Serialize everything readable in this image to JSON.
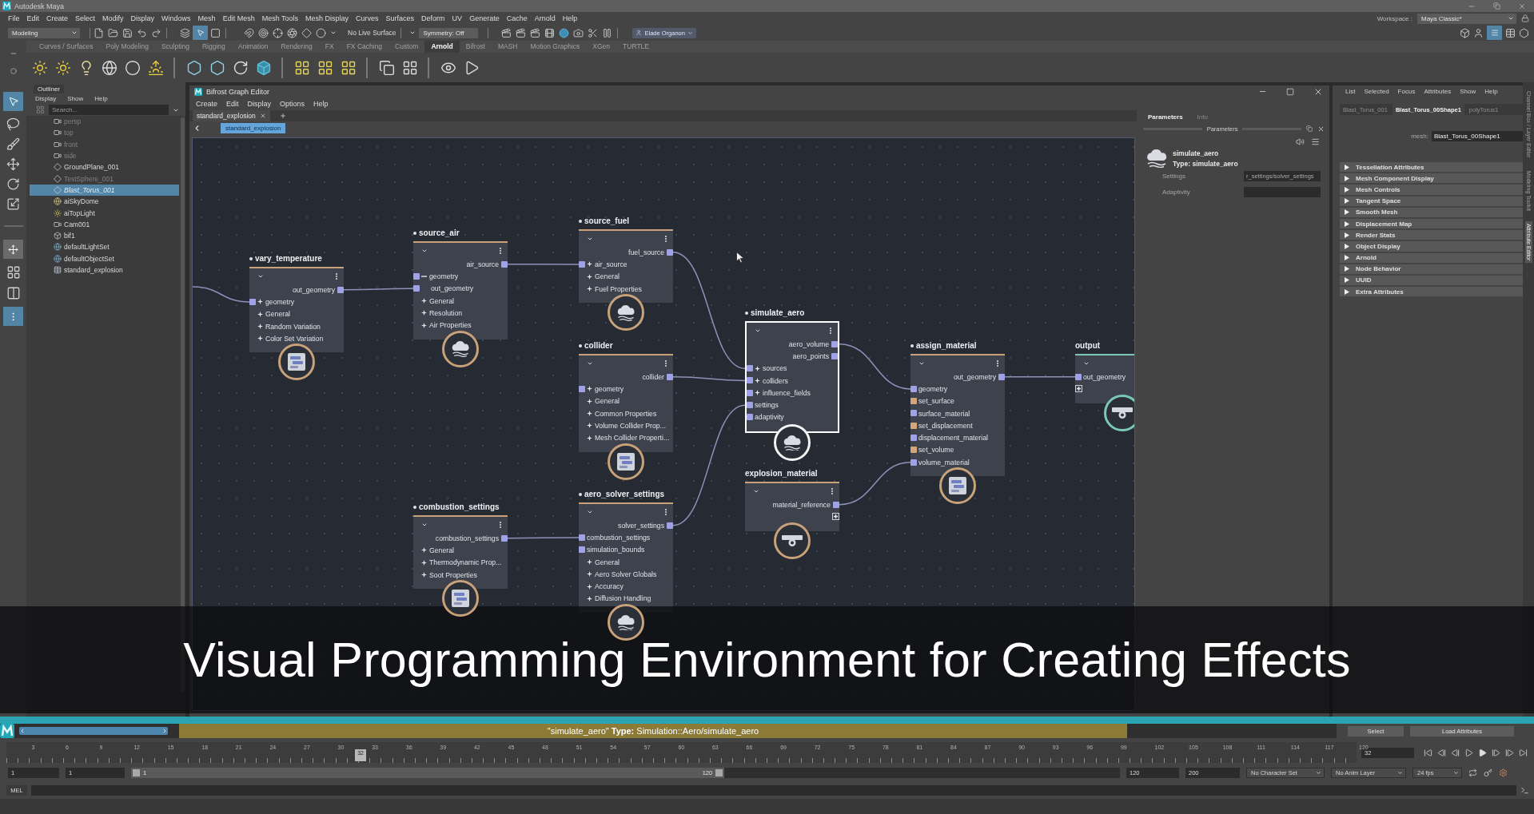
{
  "window": {
    "title": "Autodesk Maya"
  },
  "menu_bar": {
    "items": [
      "File",
      "Edit",
      "Create",
      "Select",
      "Modify",
      "Display",
      "Windows",
      "Mesh",
      "Edit Mesh",
      "Mesh Tools",
      "Mesh Display",
      "Curves",
      "Surfaces",
      "Deform",
      "UV",
      "Generate",
      "Cache",
      "Arnold",
      "Help"
    ],
    "workspace_label": "Workspace :",
    "workspace": "Maya Classic*"
  },
  "status_line": {
    "mode": "Modeling",
    "live_surface": "No Live Surface",
    "symmetry": "Symmetry: Off",
    "account": "Elade Organon"
  },
  "shelf": {
    "tabs": [
      {
        "label": "Curves / Surfaces",
        "selected": false
      },
      {
        "label": "Poly Modeling",
        "selected": false
      },
      {
        "label": "Sculpting",
        "selected": false
      },
      {
        "label": "Rigging",
        "selected": false
      },
      {
        "label": "Animation",
        "selected": false
      },
      {
        "label": "Rendering",
        "selected": false
      },
      {
        "label": "FX",
        "selected": false
      },
      {
        "label": "FX Caching",
        "selected": false
      },
      {
        "label": "Custom",
        "selected": false
      },
      {
        "label": "Arnold",
        "selected": true
      },
      {
        "label": "Bifrost",
        "selected": false
      },
      {
        "label": "MASH",
        "selected": false
      },
      {
        "label": "Motion Graphics",
        "selected": false
      },
      {
        "label": "XGen",
        "selected": false
      },
      {
        "label": "TURTLE",
        "selected": false
      }
    ]
  },
  "outliner": {
    "title": "Outliner",
    "menu": [
      "Display",
      "Show",
      "Help"
    ],
    "search_placeholder": "Search...",
    "items": [
      {
        "label": "persp",
        "kind": "camera",
        "hidden": true,
        "selected": false
      },
      {
        "label": "top",
        "kind": "camera",
        "hidden": true,
        "selected": false
      },
      {
        "label": "front",
        "kind": "camera",
        "hidden": true,
        "selected": false
      },
      {
        "label": "side",
        "kind": "camera",
        "hidden": true,
        "selected": false
      },
      {
        "label": "GroundPlane_001",
        "kind": "mesh",
        "hidden": false,
        "selected": false
      },
      {
        "label": "TestSphere_001",
        "kind": "mesh",
        "hidden": true,
        "selected": false
      },
      {
        "label": "Blast_Torus_001",
        "kind": "mesh",
        "hidden": true,
        "selected": true
      },
      {
        "label": "aiSkyDome",
        "kind": "dome",
        "hidden": false,
        "selected": false
      },
      {
        "label": "aiTopLight",
        "kind": "light",
        "hidden": false,
        "selected": false
      },
      {
        "label": "Cam001",
        "kind": "camera",
        "hidden": false,
        "selected": false
      },
      {
        "label": "bif1",
        "kind": "bifrost",
        "hidden": false,
        "selected": false
      },
      {
        "label": "defaultLightSet",
        "kind": "set",
        "hidden": false,
        "selected": false
      },
      {
        "label": "defaultObjectSet",
        "kind": "set",
        "hidden": false,
        "selected": false
      },
      {
        "label": "standard_explosion",
        "kind": "graph",
        "hidden": false,
        "selected": false
      }
    ]
  },
  "graph_editor": {
    "title": "Bifrost Graph Editor",
    "menu": [
      "Create",
      "Edit",
      "Display",
      "Options",
      "Help"
    ],
    "tabs": [
      {
        "label": "standard_explosion",
        "selected": true
      }
    ],
    "breadcrumb": "standard_explosion",
    "nodes": [
      {
        "title": "vary_temperature",
        "dot_marker": true,
        "selected": false,
        "kind": "compound",
        "color": "#c9a27a",
        "rows": [
          {
            "label": "out_geometry",
            "kind": "output",
            "color": "#9fa2e6"
          },
          {
            "label": "geometry",
            "kind": "group",
            "expanded": false,
            "color": "#9fa2e6"
          },
          {
            "label": "General",
            "kind": "group",
            "expanded": false
          },
          {
            "label": "Random Variation",
            "kind": "group",
            "expanded": false
          },
          {
            "label": "Color Set Variation",
            "kind": "group",
            "expanded": false
          }
        ]
      },
      {
        "title": "source_air",
        "dot_marker": true,
        "selected": false,
        "kind": "simulation",
        "color": "#c9a27a",
        "rows": [
          {
            "label": "air_source",
            "kind": "output",
            "color": "#9fa2e6"
          },
          {
            "label": "geometry",
            "kind": "group",
            "expanded": true,
            "color": "#9fa2e6",
            "children": [
              {
                "label": "out_geometry",
                "kind": "input",
                "color": "#9fa2e6"
              }
            ]
          },
          {
            "label": "General",
            "kind": "group",
            "expanded": false
          },
          {
            "label": "Resolution",
            "kind": "group",
            "expanded": false
          },
          {
            "label": "Air Properties",
            "kind": "group",
            "expanded": false
          }
        ]
      },
      {
        "title": "combustion_settings",
        "dot_marker": true,
        "selected": false,
        "kind": "compound",
        "color": "#c9a27a",
        "rows": [
          {
            "label": "combustion_settings",
            "kind": "output",
            "color": "#9fa2e6"
          },
          {
            "label": "General",
            "kind": "group",
            "expanded": false
          },
          {
            "label": "Thermodynamic Prop...",
            "kind": "group",
            "expanded": false
          },
          {
            "label": "Soot Properties",
            "kind": "group",
            "expanded": false
          }
        ]
      },
      {
        "title": "source_fuel",
        "dot_marker": true,
        "selected": false,
        "kind": "simulation",
        "color": "#c9a27a",
        "rows": [
          {
            "label": "fuel_source",
            "kind": "output",
            "color": "#9fa2e6"
          },
          {
            "label": "air_source",
            "kind": "group",
            "expanded": false,
            "color": "#9fa2e6"
          },
          {
            "label": "General",
            "kind": "group",
            "expanded": false
          },
          {
            "label": "Fuel Properties",
            "kind": "group",
            "expanded": false
          }
        ]
      },
      {
        "title": "collider",
        "dot_marker": true,
        "selected": false,
        "kind": "compound",
        "color": "#c9a27a",
        "rows": [
          {
            "label": "collider",
            "kind": "output",
            "color": "#9fa2e6"
          },
          {
            "label": "geometry",
            "kind": "group",
            "expanded": false,
            "color": "#9fa2e6"
          },
          {
            "label": "General",
            "kind": "group",
            "expanded": false
          },
          {
            "label": "Common Properties",
            "kind": "group",
            "expanded": false
          },
          {
            "label": "Volume Collider Prop...",
            "kind": "group",
            "expanded": false
          },
          {
            "label": "Mesh Collider Properti...",
            "kind": "group",
            "expanded": false
          }
        ]
      },
      {
        "title": "aero_solver_settings",
        "dot_marker": true,
        "selected": false,
        "kind": "simulation",
        "color": "#c9a27a",
        "rows": [
          {
            "label": "solver_settings",
            "kind": "output",
            "color": "#9fa2e6"
          },
          {
            "label": "combustion_settings",
            "kind": "input",
            "color": "#9fa2e6"
          },
          {
            "label": "simulation_bounds",
            "kind": "input",
            "color": "#9fa2e6"
          },
          {
            "label": "General",
            "kind": "group",
            "expanded": false
          },
          {
            "label": "Aero Solver Globals",
            "kind": "group",
            "expanded": false
          },
          {
            "label": "Accuracy",
            "kind": "group",
            "expanded": false
          },
          {
            "label": "Diffusion Handling",
            "kind": "group",
            "expanded": false
          }
        ]
      },
      {
        "title": "simulate_aero",
        "dot_marker": true,
        "selected": true,
        "kind": "simulation",
        "rows": [
          {
            "label": "aero_volume",
            "kind": "output",
            "color": "#9fa2e6"
          },
          {
            "label": "aero_points",
            "kind": "output",
            "color": "#9fa2e6"
          },
          {
            "label": "sources",
            "kind": "group",
            "expanded": false,
            "color": "#9fa2e6"
          },
          {
            "label": "colliders",
            "kind": "group",
            "expanded": false,
            "color": "#9fa2e6"
          },
          {
            "label": "influence_fields",
            "kind": "group",
            "expanded": false,
            "color": "#9fa2e6"
          },
          {
            "label": "settings",
            "kind": "input",
            "color": "#9fa2e6"
          },
          {
            "label": "adaptivity",
            "kind": "input",
            "color": "#9fa2e6"
          }
        ]
      },
      {
        "title": "explosion_material",
        "dot_marker": false,
        "selected": false,
        "kind": "material",
        "color": "#c9a27a",
        "rows": [
          {
            "label": "material_reference",
            "kind": "output",
            "color": "#9fa2e6"
          },
          {
            "kind": "add-out"
          }
        ]
      },
      {
        "title": "assign_material",
        "dot_marker": true,
        "selected": false,
        "kind": "compound",
        "color": "#c9a27a",
        "rows": [
          {
            "label": "out_geometry",
            "kind": "output",
            "color": "#9fa2e6"
          },
          {
            "label": "geometry",
            "kind": "input",
            "color": "#9fa2e6"
          },
          {
            "label": "set_surface",
            "kind": "input",
            "color": "#d4a57c"
          },
          {
            "label": "surface_material",
            "kind": "input",
            "color": "#9fa2e6"
          },
          {
            "label": "set_displacement",
            "kind": "input",
            "color": "#d4a57c"
          },
          {
            "label": "displacement_material",
            "kind": "input",
            "color": "#9fa2e6"
          },
          {
            "label": "set_volume",
            "kind": "input",
            "color": "#d4a57c"
          },
          {
            "label": "volume_material",
            "kind": "input",
            "color": "#9fa2e6"
          }
        ]
      },
      {
        "title": "output",
        "dot_marker": false,
        "selected": false,
        "kind": "terminal",
        "color": "#7cc7b5",
        "rows": [
          {
            "label": "out_geometry",
            "kind": "input",
            "color": "#9fa2e6"
          },
          {
            "kind": "add-in"
          }
        ]
      }
    ],
    "params": {
      "tabs": [
        {
          "label": "Parameters",
          "selected": true
        },
        {
          "label": "Info",
          "selected": false
        }
      ],
      "heading": "Parameters",
      "node_name": "simulate_aero",
      "node_type": "Type: simulate_aero",
      "fields": [
        {
          "label": "Settings",
          "value": "r_settings/solver_settings"
        },
        {
          "label": "Adaptivity"
        }
      ]
    }
  },
  "attribute_editor": {
    "menu": [
      "List",
      "Selected",
      "Focus",
      "Attributes",
      "Show",
      "Help"
    ],
    "tabs": [
      {
        "label": "Blast_Torus_001",
        "selected": false
      },
      {
        "label": "Blast_Torus_00Shape1",
        "selected": true
      },
      {
        "label": "polyTorus1",
        "selected": false
      }
    ],
    "field_label": "mesh:",
    "field_value": "Blast_Torus_00Shape1",
    "sections": [
      {
        "label": "Tessellation Attributes",
        "expanded": false
      },
      {
        "label": "Mesh Component Display",
        "expanded": false
      },
      {
        "label": "Mesh Controls",
        "expanded": false
      },
      {
        "label": "Tangent Space",
        "expanded": false
      },
      {
        "label": "Smooth Mesh",
        "expanded": false
      },
      {
        "label": "Displacement Map",
        "expanded": false
      },
      {
        "label": "Render Stats",
        "expanded": false
      },
      {
        "label": "Object Display",
        "expanded": false
      },
      {
        "label": "Arnold",
        "expanded": false
      },
      {
        "label": "Node Behavior",
        "expanded": false
      },
      {
        "label": "UUID",
        "expanded": false
      },
      {
        "label": "Extra Attributes",
        "expanded": false
      }
    ]
  },
  "side_tabs": [
    {
      "label": "Channel Box / Layer Editor",
      "selected": false
    },
    {
      "label": "Modeling Toolkit",
      "selected": false
    },
    {
      "label": "Attribute Editor",
      "selected": true
    }
  ],
  "caption": "Visual Programming Environment for Creating Effects",
  "help_line": {
    "message": "\"simulate_aero\" **Type:** Simulation::Aero/simulate_aero",
    "buttons": [
      "Select",
      "Load Attributes"
    ]
  },
  "time_slider": {
    "ticks": [
      "3",
      "6",
      "9",
      "12",
      "15",
      "18",
      "21",
      "24",
      "27",
      "30",
      "33",
      "36",
      "39",
      "42",
      "45",
      "48",
      "51",
      "54",
      "57",
      "60",
      "63",
      "66",
      "69",
      "72",
      "75",
      "78",
      "81",
      "84",
      "87",
      "90",
      "93",
      "96",
      "99",
      "102",
      "105",
      "108",
      "111",
      "114",
      "117",
      "120"
    ],
    "marker_label": "32",
    "level": 0.26,
    "frame_field": "32"
  },
  "range_slider": {
    "start": "1",
    "playback_start": "1",
    "handle_start": "1",
    "handle_end": "120",
    "level": 0.6,
    "playback_end": "120",
    "end": "200",
    "character_set": "No Character Set",
    "anim_layer": "No Anim Layer",
    "fps": "24 fps"
  },
  "command_line": {
    "language": "MEL"
  }
}
